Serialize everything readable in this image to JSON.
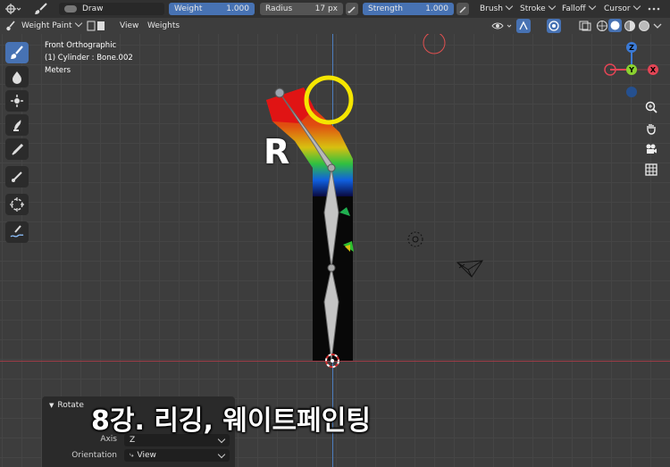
{
  "header": {
    "mode_label": "Draw",
    "weight": {
      "label": "Weight",
      "value": "1.000"
    },
    "radius": {
      "label": "Radius",
      "value": "17 px"
    },
    "strength": {
      "label": "Strength",
      "value": "1.000"
    },
    "menus": [
      "Brush",
      "Stroke",
      "Falloff",
      "Cursor"
    ]
  },
  "viewport_header": {
    "mode": "Weight Paint",
    "menus": [
      "View",
      "Weights"
    ]
  },
  "overlay": {
    "view_name": "Front Orthographic",
    "object_info": "(1) Cylinder : Bone.002",
    "units": "Meters"
  },
  "gizmo": {
    "z": "Z",
    "y": "Y",
    "x": "X"
  },
  "annotation_letter": "R",
  "caption": "8강. 리깅, 웨이트페인팅",
  "panel": {
    "title": "Rotate",
    "axis_label": "Axis",
    "axis_value": "Z",
    "orientation_label": "Orientation",
    "orientation_value": "View"
  },
  "colors": {
    "accent": "#4772b3",
    "highlight_circle": "#f5e600",
    "x_axis": "#e34555",
    "y_axis": "#8ad12f",
    "z_axis": "#3b7ad6"
  }
}
